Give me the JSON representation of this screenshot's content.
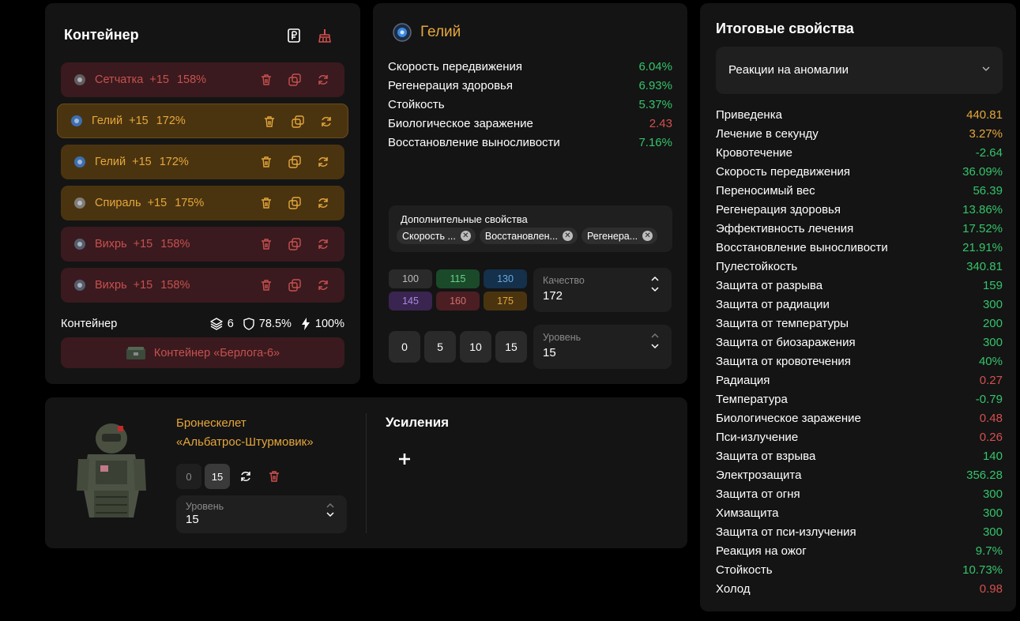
{
  "container": {
    "title": "Контейнер",
    "items": [
      {
        "name": "Сетчатка",
        "level": "+15",
        "quality": "158%",
        "tone": "red",
        "art": "#6a6a6a"
      },
      {
        "name": "Гелий",
        "level": "+15",
        "quality": "172%",
        "tone": "gold",
        "art": "#3a7ad0",
        "selected": true
      },
      {
        "name": "Гелий",
        "level": "+15",
        "quality": "172%",
        "tone": "gold",
        "art": "#3a7ad0"
      },
      {
        "name": "Спираль",
        "level": "+15",
        "quality": "175%",
        "tone": "gold",
        "art": "#8a8a8a"
      },
      {
        "name": "Вихрь",
        "level": "+15",
        "quality": "158%",
        "tone": "red",
        "art": "#5a6a7a"
      },
      {
        "name": "Вихрь",
        "level": "+15",
        "quality": "158%",
        "tone": "red",
        "art": "#5a6a7a"
      }
    ],
    "footer_label": "Контейнер",
    "slots": "6",
    "protection": "78.5%",
    "energy": "100%",
    "picker_label": "Контейнер «Берлога-6»"
  },
  "artifact": {
    "name": "Гелий",
    "stats": [
      {
        "label": "Скорость передвижения",
        "value": "6.04%",
        "tone": "g"
      },
      {
        "label": "Регенерация здоровья",
        "value": "6.93%",
        "tone": "g"
      },
      {
        "label": "Стойкость",
        "value": "5.37%",
        "tone": "g"
      },
      {
        "label": "Биологическое заражение",
        "value": "2.43",
        "tone": "r"
      },
      {
        "label": "Восстановление выносливости",
        "value": "7.16%",
        "tone": "g"
      }
    ],
    "extra_label": "Дополнительные свойства",
    "extra_chips": [
      "Скорость ...",
      "Восстановлен...",
      "Регенера..."
    ],
    "quality_presets": [
      {
        "value": "100",
        "bg": "#2a2a2a",
        "fg": "#bcbcbc"
      },
      {
        "value": "115",
        "bg": "#1a4a2a",
        "fg": "#6ad08a"
      },
      {
        "value": "130",
        "bg": "#14304a",
        "fg": "#6aa8e0"
      },
      {
        "value": "145",
        "bg": "#3a2450",
        "fg": "#a88ae0"
      },
      {
        "value": "160",
        "bg": "#4a1e22",
        "fg": "#d07070"
      },
      {
        "value": "175",
        "bg": "#4a3410",
        "fg": "#e6a73a"
      }
    ],
    "quality_label": "Качество",
    "quality_value": "172",
    "level_presets": [
      "0",
      "5",
      "10",
      "15"
    ],
    "level_label": "Уровень",
    "level_value": "15"
  },
  "armor": {
    "name_line1": "Бронескелет",
    "name_line2": "«Альбатрос-Штурмовик»",
    "levels": [
      "0",
      "15"
    ],
    "level_label": "Уровень",
    "level_value": "15",
    "boosts_title": "Усиления"
  },
  "summary": {
    "title": "Итоговые свойства",
    "filter": "Реакции на аномалии",
    "stats": [
      {
        "label": "Приведенка",
        "value": "440.81",
        "tone": "o"
      },
      {
        "label": "Лечение в секунду",
        "value": "3.27%",
        "tone": "o"
      },
      {
        "label": "Кровотечение",
        "value": "-2.64",
        "tone": "g"
      },
      {
        "label": "Скорость передвижения",
        "value": "36.09%",
        "tone": "g"
      },
      {
        "label": "Переносимый вес",
        "value": "56.39",
        "tone": "g"
      },
      {
        "label": "Регенерация здоровья",
        "value": "13.86%",
        "tone": "g"
      },
      {
        "label": "Эффективность лечения",
        "value": "17.52%",
        "tone": "g"
      },
      {
        "label": "Восстановление выносливости",
        "value": "21.91%",
        "tone": "g"
      },
      {
        "label": "Пулестойкость",
        "value": "340.81",
        "tone": "g"
      },
      {
        "label": "Защита от разрыва",
        "value": "159",
        "tone": "g"
      },
      {
        "label": "Защита от радиации",
        "value": "300",
        "tone": "g"
      },
      {
        "label": "Защита от температуры",
        "value": "200",
        "tone": "g"
      },
      {
        "label": "Защита от биозаражения",
        "value": "300",
        "tone": "g"
      },
      {
        "label": "Защита от кровотечения",
        "value": "40%",
        "tone": "g"
      },
      {
        "label": "Радиация",
        "value": "0.27",
        "tone": "r"
      },
      {
        "label": "Температура",
        "value": "-0.79",
        "tone": "g"
      },
      {
        "label": "Биологическое заражение",
        "value": "0.48",
        "tone": "r"
      },
      {
        "label": "Пси-излучение",
        "value": "0.26",
        "tone": "r"
      },
      {
        "label": "Защита от взрыва",
        "value": "140",
        "tone": "g"
      },
      {
        "label": "Электрозащита",
        "value": "356.28",
        "tone": "g"
      },
      {
        "label": "Защита от огня",
        "value": "300",
        "tone": "g"
      },
      {
        "label": "Химзащита",
        "value": "300",
        "tone": "g"
      },
      {
        "label": "Защита от пси-излучения",
        "value": "300",
        "tone": "g"
      },
      {
        "label": "Реакция на ожог",
        "value": "9.7%",
        "tone": "g"
      },
      {
        "label": "Стойкость",
        "value": "10.73%",
        "tone": "g"
      },
      {
        "label": "Холод",
        "value": "0.98",
        "tone": "r"
      }
    ]
  },
  "icons": [
    "ruble-doc-icon",
    "broom-icon",
    "trash-icon",
    "copy-icon",
    "refresh-icon",
    "layers-icon",
    "shield-icon",
    "bolt-icon",
    "chevron-up-icon",
    "chevron-down-icon",
    "plus-icon"
  ],
  "colors": {
    "green": "#34c46a",
    "red": "#d3504e",
    "gold": "#e6a73a",
    "panel": "#141414"
  }
}
